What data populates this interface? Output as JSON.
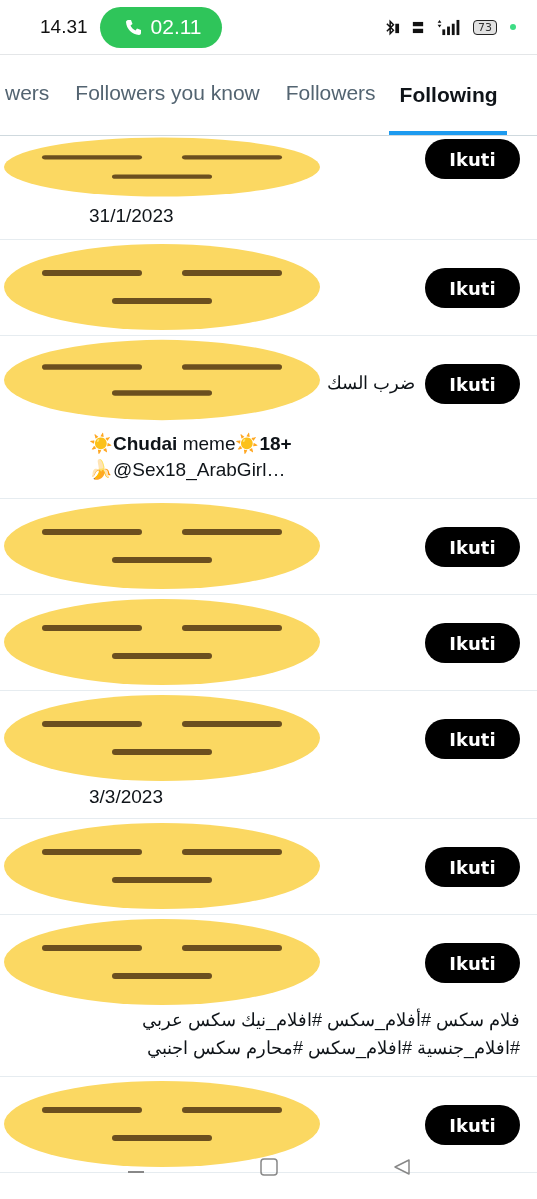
{
  "status_bar": {
    "time": "14.31",
    "call_timer": "02.11",
    "battery": "73"
  },
  "tabs": [
    {
      "label": "wers",
      "selected": false
    },
    {
      "label": "Followers you know",
      "selected": false
    },
    {
      "label": "Followers",
      "selected": false
    },
    {
      "label": "Following",
      "selected": true
    }
  ],
  "users": [
    {
      "button": "Ikuti",
      "lines": [
        "31/1/2023"
      ]
    },
    {
      "button": "Ikuti"
    },
    {
      "button": "Ikuti",
      "name": "ضرب السك",
      "lines": [
        "☀️**Chudai** meme☀️**18+**",
        "🍌@Sex18_ArabGirl…"
      ]
    },
    {
      "button": "Ikuti"
    },
    {
      "button": "Ikuti"
    },
    {
      "button": "Ikuti",
      "lines": [
        "3/3/2023"
      ]
    },
    {
      "button": "Ikuti"
    },
    {
      "button": "Ikuti",
      "rtl_lines": [
        "فلام سكس #أفلام_سكس #افلام_نيك سكس عربي",
        "#افلام_جنسية #افلام_سكس #محارم سكس اجنبي"
      ]
    },
    {
      "button": "Ikuti"
    }
  ]
}
